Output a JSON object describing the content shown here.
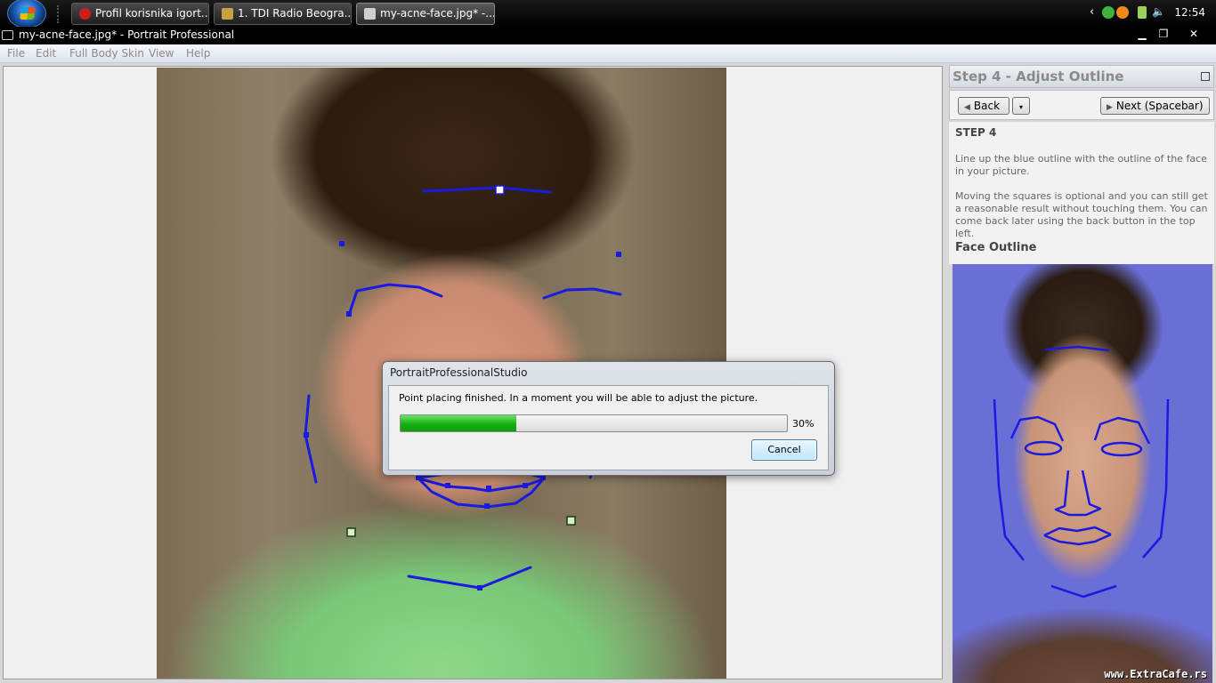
{
  "taskbar": {
    "tasks": [
      {
        "label": "Profil korisnika igort...",
        "icon": "opera-icon",
        "color": "#d21b1b"
      },
      {
        "label": "1. TDI Radio Beogra...",
        "icon": "winamp-icon",
        "color": "#c9a040"
      },
      {
        "label": "my-acne-face.jpg* -...",
        "icon": "camera-icon",
        "color": "#cfcfcf"
      }
    ],
    "clock": "12:54"
  },
  "window": {
    "title": "my-acne-face.jpg* - Portrait Professional",
    "minimize": "▁",
    "maximize": "❐",
    "close": "✕"
  },
  "menu": [
    "File",
    "Edit",
    "Full Body Skin",
    "View",
    "Help"
  ],
  "dialog": {
    "title": "PortraitProfessionalStudio",
    "message": "Point placing finished.  In a moment you will be able to adjust the picture.",
    "progress": 0.3,
    "progress_label": "30%",
    "cancel_label": "Cancel"
  },
  "panel": {
    "title": "Step 4 - Adjust Outline",
    "back_label": "Back",
    "next_label": "Next (Spacebar)",
    "step_heading": "STEP 4",
    "paragraph1": "Line up the blue outline with the outline of the face in your picture.",
    "paragraph2": "Moving the squares is optional and you can still get a reasonable result without touching them.  You can come back later using the back button in the top left.",
    "outline_heading": "Face Outline"
  },
  "colors": {
    "outline_blue": "#1a1ae0",
    "progress_green": "#13b20f",
    "panel_accent": "#6a6fd6"
  },
  "watermark": "www.ExtraCafe.rs"
}
